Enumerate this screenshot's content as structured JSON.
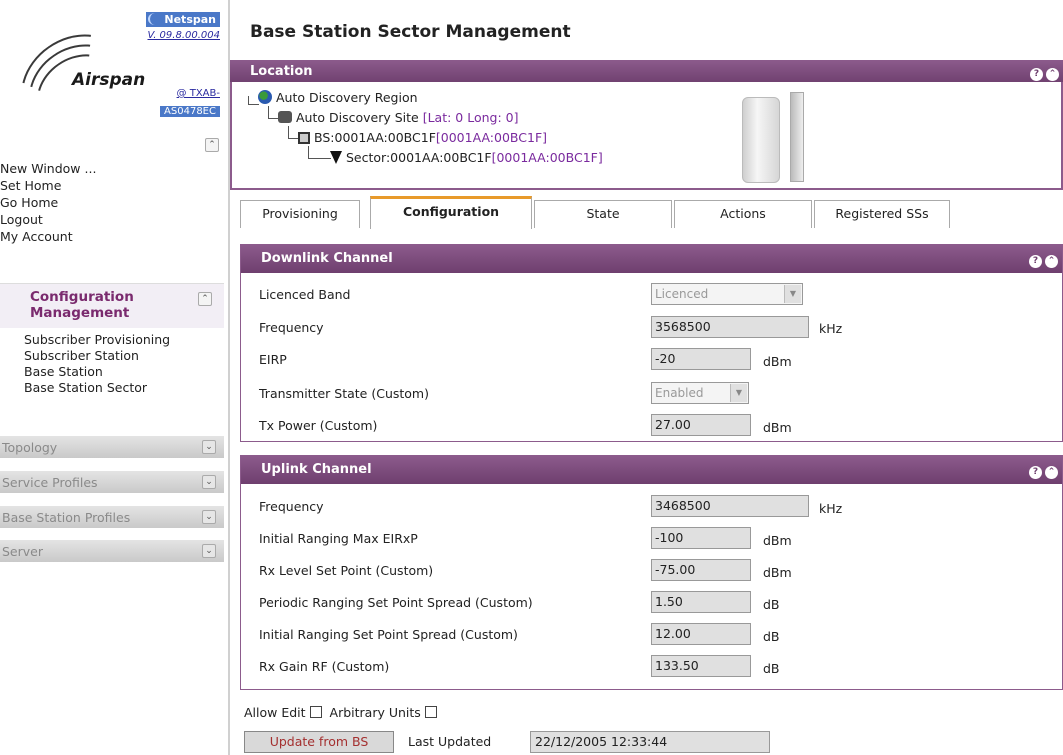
{
  "sidebar": {
    "product": "Netspan",
    "version": "V. 09.8.00.004",
    "brand": "Airspan",
    "user": "@ TXAB-",
    "user_sub": "AS0478EC",
    "quick_links": [
      "New Window ...",
      "Set Home",
      "Go Home",
      "Logout",
      "My Account"
    ],
    "config_title": "Configuration Management",
    "config_items": [
      "Subscriber Provisioning",
      "Subscriber Station",
      "Base Station",
      "Base Station Sector"
    ],
    "sections": [
      "Topology",
      "Service Profiles",
      "Base Station Profiles",
      "Server"
    ]
  },
  "page": {
    "title": "Base Station Sector Management"
  },
  "location": {
    "header": "Location",
    "region": "Auto Discovery Region",
    "site": "Auto Discovery Site",
    "site_coords": "[Lat: 0 Long: 0]",
    "bs": "BS:0001AA:00BC1F",
    "bs_id": "[0001AA:00BC1F]",
    "sector": "Sector:0001AA:00BC1F",
    "sector_id": "[0001AA:00BC1F]"
  },
  "tabs": [
    "Provisioning",
    "Configuration",
    "State",
    "Actions",
    "Registered SSs"
  ],
  "active_tab": "Configuration",
  "downlink": {
    "header": "Downlink Channel",
    "licenced_band": {
      "label": "Licenced Band",
      "value": "Licenced"
    },
    "frequency": {
      "label": "Frequency",
      "value": "3568500",
      "unit": "kHz"
    },
    "eirp": {
      "label": "EIRP",
      "value": "-20",
      "unit": "dBm"
    },
    "tx_state": {
      "label": "Transmitter State (Custom)",
      "value": "Enabled"
    },
    "tx_power": {
      "label": "Tx Power (Custom)",
      "value": "27.00",
      "unit": "dBm"
    }
  },
  "uplink": {
    "header": "Uplink Channel",
    "rows": [
      {
        "label": "Frequency",
        "value": "3468500",
        "unit": "kHz"
      },
      {
        "label": "Initial Ranging Max EIRxP",
        "value": "-100",
        "unit": "dBm"
      },
      {
        "label": "Rx Level Set Point (Custom)",
        "value": "-75.00",
        "unit": "dBm"
      },
      {
        "label": "Periodic Ranging Set Point Spread (Custom)",
        "value": "1.50",
        "unit": "dB"
      },
      {
        "label": "Initial Ranging Set Point Spread (Custom)",
        "value": "12.00",
        "unit": "dB"
      },
      {
        "label": "Rx Gain RF (Custom)",
        "value": "133.50",
        "unit": "dB"
      }
    ]
  },
  "footer": {
    "allow_edit": "Allow Edit",
    "arbitrary_units": "Arbitrary Units",
    "update_button": "Update from BS",
    "last_updated_label": "Last Updated",
    "last_updated_value": "22/12/2005 12:33:44"
  }
}
